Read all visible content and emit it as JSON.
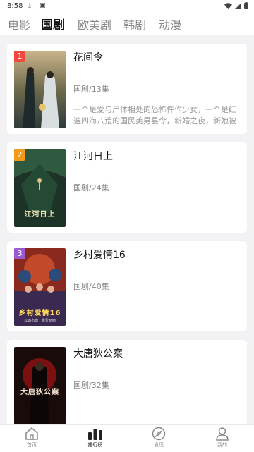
{
  "status": {
    "time": "8:58"
  },
  "tabs": [
    {
      "label": "电影",
      "active": false
    },
    {
      "label": "国剧",
      "active": true
    },
    {
      "label": "欧美剧",
      "active": false
    },
    {
      "label": "韩剧",
      "active": false
    },
    {
      "label": "动漫",
      "active": false
    }
  ],
  "items": [
    {
      "rank": "1",
      "rank_color": "#f04a3e",
      "title": "花间令",
      "meta": "国剧/13集",
      "desc": "一个是爱与尸体相处的恐怖仵作少女，一个是红遍四海八荒的国民美男县令，新婚之夜，新娘被杀，死里逃生，改头易面，怪…",
      "poster_caption": "",
      "poster_sub": ""
    },
    {
      "rank": "2",
      "rank_color": "#f39a1a",
      "title": "江河日上",
      "meta": "国剧/24集",
      "desc": "",
      "poster_caption": "江河日上",
      "poster_sub": ""
    },
    {
      "rank": "3",
      "rank_color": "#9b59d0",
      "title": "乡村爱情16",
      "meta": "国剧/40集",
      "desc": "",
      "poster_caption": "乡村爱情16",
      "poster_sub": "以诚布典 · 最爱面面"
    },
    {
      "rank": "",
      "rank_color": "",
      "title": "大唐狄公案",
      "meta": "国剧/32集",
      "desc": "",
      "poster_caption": "大唐狄公案",
      "poster_sub": ""
    }
  ],
  "nav": [
    {
      "label": "首页",
      "icon": "home-icon",
      "active": false
    },
    {
      "label": "排行榜",
      "icon": "ranking-icon",
      "active": true
    },
    {
      "label": "发现",
      "icon": "compass-icon",
      "active": false
    },
    {
      "label": "我的",
      "icon": "user-icon",
      "active": false
    }
  ]
}
